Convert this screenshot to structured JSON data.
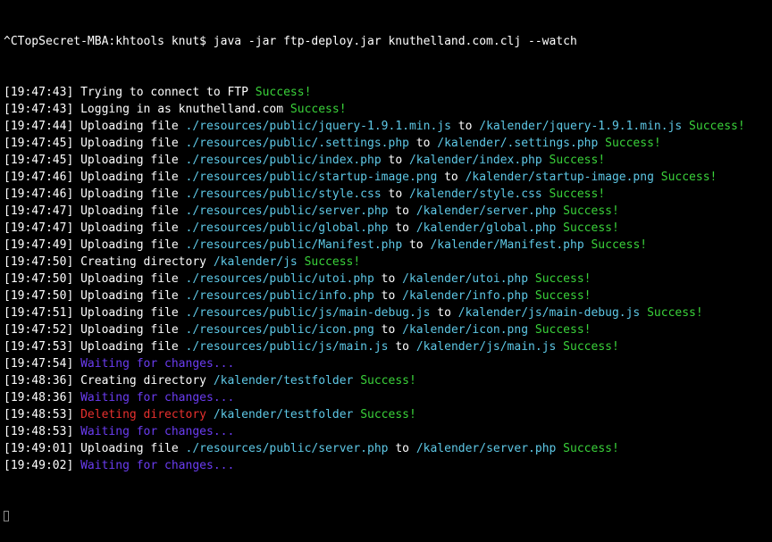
{
  "terminal": {
    "prompt": "^CTopSecret-MBA:khtools knut$ java -jar ftp-deploy.jar knuthelland.com.clj --watch",
    "colors": {
      "default": "#ffffff",
      "path": "#5ec8e6",
      "success": "#3ad23a",
      "waiting": "#6a3cf0",
      "delete": "#e8302e",
      "background": "#000000"
    },
    "lines": [
      {
        "ts": "[19:47:43]",
        "parts": [
          {
            "t": "Trying to connect to FTP ",
            "c": "white"
          },
          {
            "t": "Success!",
            "c": "green"
          }
        ]
      },
      {
        "ts": "[19:47:43]",
        "parts": [
          {
            "t": "Logging in as knuthelland.com ",
            "c": "white"
          },
          {
            "t": "Success!",
            "c": "green"
          }
        ]
      },
      {
        "ts": "[19:47:44]",
        "parts": [
          {
            "t": "Uploading file ",
            "c": "white"
          },
          {
            "t": "./resources/public/jquery-1.9.1.min.js",
            "c": "cyan"
          },
          {
            "t": " to ",
            "c": "white"
          },
          {
            "t": "/kalender/jquery-1.9.1.min.js",
            "c": "cyan"
          },
          {
            "t": " Success!",
            "c": "green"
          }
        ]
      },
      {
        "ts": "[19:47:45]",
        "parts": [
          {
            "t": "Uploading file ",
            "c": "white"
          },
          {
            "t": "./resources/public/.settings.php",
            "c": "cyan"
          },
          {
            "t": " to ",
            "c": "white"
          },
          {
            "t": "/kalender/.settings.php",
            "c": "cyan"
          },
          {
            "t": " Success!",
            "c": "green"
          }
        ]
      },
      {
        "ts": "[19:47:45]",
        "parts": [
          {
            "t": "Uploading file ",
            "c": "white"
          },
          {
            "t": "./resources/public/index.php",
            "c": "cyan"
          },
          {
            "t": " to ",
            "c": "white"
          },
          {
            "t": "/kalender/index.php",
            "c": "cyan"
          },
          {
            "t": " Success!",
            "c": "green"
          }
        ]
      },
      {
        "ts": "[19:47:46]",
        "parts": [
          {
            "t": "Uploading file ",
            "c": "white"
          },
          {
            "t": "./resources/public/startup-image.png",
            "c": "cyan"
          },
          {
            "t": " to ",
            "c": "white"
          },
          {
            "t": "/kalender/startup-image.png",
            "c": "cyan"
          },
          {
            "t": " Success!",
            "c": "green"
          }
        ]
      },
      {
        "ts": "[19:47:46]",
        "parts": [
          {
            "t": "Uploading file ",
            "c": "white"
          },
          {
            "t": "./resources/public/style.css",
            "c": "cyan"
          },
          {
            "t": " to ",
            "c": "white"
          },
          {
            "t": "/kalender/style.css",
            "c": "cyan"
          },
          {
            "t": " Success!",
            "c": "green"
          }
        ]
      },
      {
        "ts": "[19:47:47]",
        "parts": [
          {
            "t": "Uploading file ",
            "c": "white"
          },
          {
            "t": "./resources/public/server.php",
            "c": "cyan"
          },
          {
            "t": " to ",
            "c": "white"
          },
          {
            "t": "/kalender/server.php",
            "c": "cyan"
          },
          {
            "t": " Success!",
            "c": "green"
          }
        ]
      },
      {
        "ts": "[19:47:47]",
        "parts": [
          {
            "t": "Uploading file ",
            "c": "white"
          },
          {
            "t": "./resources/public/global.php",
            "c": "cyan"
          },
          {
            "t": " to ",
            "c": "white"
          },
          {
            "t": "/kalender/global.php",
            "c": "cyan"
          },
          {
            "t": " Success!",
            "c": "green"
          }
        ]
      },
      {
        "ts": "[19:47:49]",
        "parts": [
          {
            "t": "Uploading file ",
            "c": "white"
          },
          {
            "t": "./resources/public/Manifest.php",
            "c": "cyan"
          },
          {
            "t": " to ",
            "c": "white"
          },
          {
            "t": "/kalender/Manifest.php",
            "c": "cyan"
          },
          {
            "t": " Success!",
            "c": "green"
          }
        ]
      },
      {
        "ts": "[19:47:50]",
        "parts": [
          {
            "t": "Creating directory ",
            "c": "white"
          },
          {
            "t": "/kalender/js",
            "c": "cyan"
          },
          {
            "t": " Success!",
            "c": "green"
          }
        ]
      },
      {
        "ts": "[19:47:50]",
        "parts": [
          {
            "t": "Uploading file ",
            "c": "white"
          },
          {
            "t": "./resources/public/utoi.php",
            "c": "cyan"
          },
          {
            "t": " to ",
            "c": "white"
          },
          {
            "t": "/kalender/utoi.php",
            "c": "cyan"
          },
          {
            "t": " Success!",
            "c": "green"
          }
        ]
      },
      {
        "ts": "[19:47:50]",
        "parts": [
          {
            "t": "Uploading file ",
            "c": "white"
          },
          {
            "t": "./resources/public/info.php",
            "c": "cyan"
          },
          {
            "t": " to ",
            "c": "white"
          },
          {
            "t": "/kalender/info.php",
            "c": "cyan"
          },
          {
            "t": " Success!",
            "c": "green"
          }
        ]
      },
      {
        "ts": "[19:47:51]",
        "parts": [
          {
            "t": "Uploading file ",
            "c": "white"
          },
          {
            "t": "./resources/public/js/main-debug.js",
            "c": "cyan"
          },
          {
            "t": " to ",
            "c": "white"
          },
          {
            "t": "/kalender/js/main-debug.js",
            "c": "cyan"
          },
          {
            "t": " Success!",
            "c": "green"
          }
        ]
      },
      {
        "ts": "[19:47:52]",
        "parts": [
          {
            "t": "Uploading file ",
            "c": "white"
          },
          {
            "t": "./resources/public/icon.png",
            "c": "cyan"
          },
          {
            "t": " to ",
            "c": "white"
          },
          {
            "t": "/kalender/icon.png",
            "c": "cyan"
          },
          {
            "t": " Success!",
            "c": "green"
          }
        ]
      },
      {
        "ts": "[19:47:53]",
        "parts": [
          {
            "t": "Uploading file ",
            "c": "white"
          },
          {
            "t": "./resources/public/js/main.js",
            "c": "cyan"
          },
          {
            "t": " to ",
            "c": "white"
          },
          {
            "t": "/kalender/js/main.js",
            "c": "cyan"
          },
          {
            "t": " Success!",
            "c": "green"
          }
        ]
      },
      {
        "ts": "[19:47:54]",
        "parts": [
          {
            "t": "Waiting for changes...",
            "c": "purple"
          }
        ]
      },
      {
        "ts": "[19:48:36]",
        "parts": [
          {
            "t": "Creating directory ",
            "c": "white"
          },
          {
            "t": "/kalender/testfolder",
            "c": "cyan"
          },
          {
            "t": " Success!",
            "c": "green"
          }
        ]
      },
      {
        "ts": "[19:48:36]",
        "parts": [
          {
            "t": "Waiting for changes...",
            "c": "purple"
          }
        ]
      },
      {
        "ts": "[19:48:53]",
        "parts": [
          {
            "t": "Deleting directory ",
            "c": "red"
          },
          {
            "t": "/kalender/testfolder",
            "c": "cyan"
          },
          {
            "t": " Success!",
            "c": "green"
          }
        ]
      },
      {
        "ts": "[19:48:53]",
        "parts": [
          {
            "t": "Waiting for changes...",
            "c": "purple"
          }
        ]
      },
      {
        "ts": "[19:49:01]",
        "parts": [
          {
            "t": "Uploading file ",
            "c": "white"
          },
          {
            "t": "./resources/public/server.php",
            "c": "cyan"
          },
          {
            "t": " to ",
            "c": "white"
          },
          {
            "t": "/kalender/server.php",
            "c": "cyan"
          },
          {
            "t": " Success!",
            "c": "green"
          }
        ]
      },
      {
        "ts": "[19:49:02]",
        "parts": [
          {
            "t": "Waiting for changes...",
            "c": "purple"
          }
        ]
      }
    ]
  }
}
